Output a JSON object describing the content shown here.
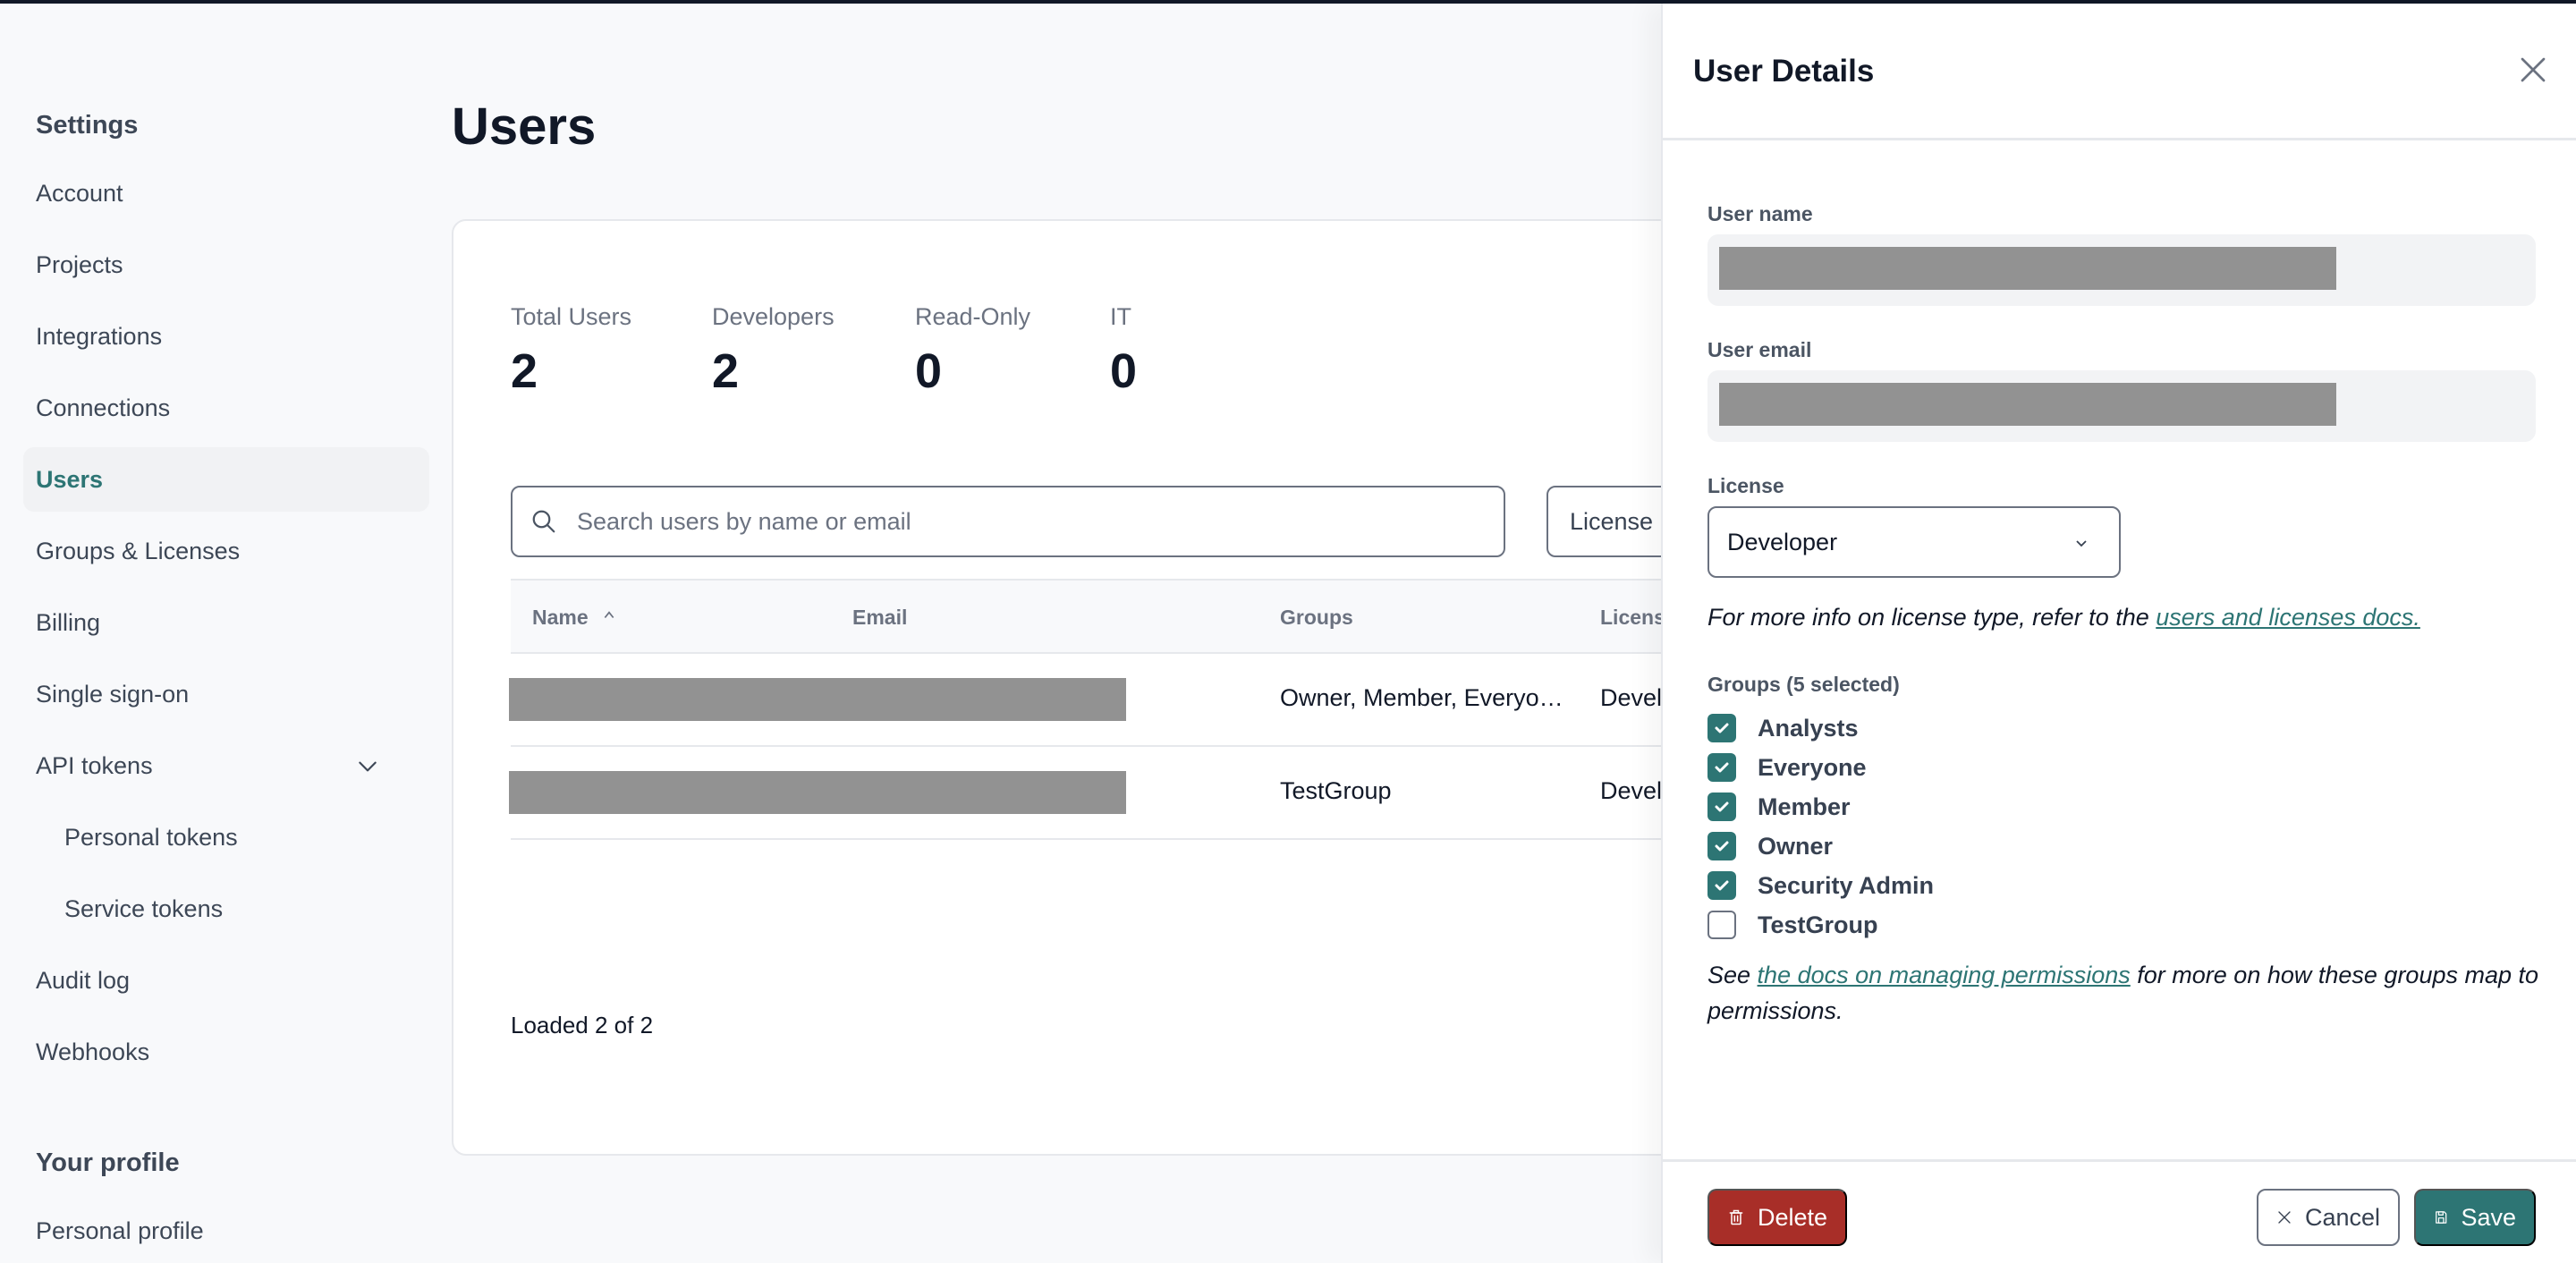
{
  "sidebar": {
    "heading": "Settings",
    "items": [
      {
        "label": "Account"
      },
      {
        "label": "Projects"
      },
      {
        "label": "Integrations"
      },
      {
        "label": "Connections"
      },
      {
        "label": "Users",
        "active": true
      },
      {
        "label": "Groups & Licenses"
      },
      {
        "label": "Billing"
      },
      {
        "label": "Single sign-on"
      },
      {
        "label": "API tokens",
        "expanded": true
      },
      {
        "label": "Personal tokens"
      },
      {
        "label": "Service tokens"
      },
      {
        "label": "Audit log"
      },
      {
        "label": "Webhooks"
      }
    ],
    "profile_heading": "Your profile",
    "profile_items": [
      {
        "label": "Personal profile"
      }
    ]
  },
  "main": {
    "title": "Users",
    "stats": [
      {
        "label": "Total Users",
        "value": "2"
      },
      {
        "label": "Developers",
        "value": "2"
      },
      {
        "label": "Read-Only",
        "value": "0"
      },
      {
        "label": "IT",
        "value": "0"
      }
    ],
    "search": {
      "placeholder": "Search users by name or email",
      "value": ""
    },
    "license_filter": "License",
    "table": {
      "columns": [
        "Name",
        "Email",
        "Groups",
        "License"
      ],
      "sort": {
        "column": "Name",
        "direction": "ascending"
      },
      "rows": [
        {
          "name": "[redacted]",
          "email": "[redacted]",
          "groups": "Owner, Member, Everyo…",
          "license": "Developer"
        },
        {
          "name": "[redacted]",
          "email": "[redacted]",
          "groups": "TestGroup",
          "license": "Developer"
        }
      ]
    },
    "loaded_text": "Loaded 2 of 2"
  },
  "drawer": {
    "title": "User Details",
    "user_name_label": "User name",
    "user_name_value": "[redacted]",
    "user_email_label": "User email",
    "user_email_value": "[redacted]",
    "license_label": "License",
    "license_value": "Developer",
    "license_help_prefix": "For more info on license type, refer to the ",
    "license_help_link": "users and licenses docs.",
    "groups_label": "Groups (5 selected)",
    "groups": [
      {
        "name": "Analysts",
        "checked": true
      },
      {
        "name": "Everyone",
        "checked": true
      },
      {
        "name": "Member",
        "checked": true
      },
      {
        "name": "Owner",
        "checked": true
      },
      {
        "name": "Security Admin",
        "checked": true
      },
      {
        "name": "TestGroup",
        "checked": false
      }
    ],
    "permissions_help_prefix": "See ",
    "permissions_help_link": "the docs on managing permissions",
    "permissions_help_suffix": " for more on how these groups map to permissions.",
    "buttons": {
      "delete": "Delete",
      "cancel": "Cancel",
      "save": "Save"
    }
  },
  "colors": {
    "accent": "#2d7574",
    "danger": "#a82e28",
    "text": "#111827",
    "muted": "#6b7280"
  }
}
